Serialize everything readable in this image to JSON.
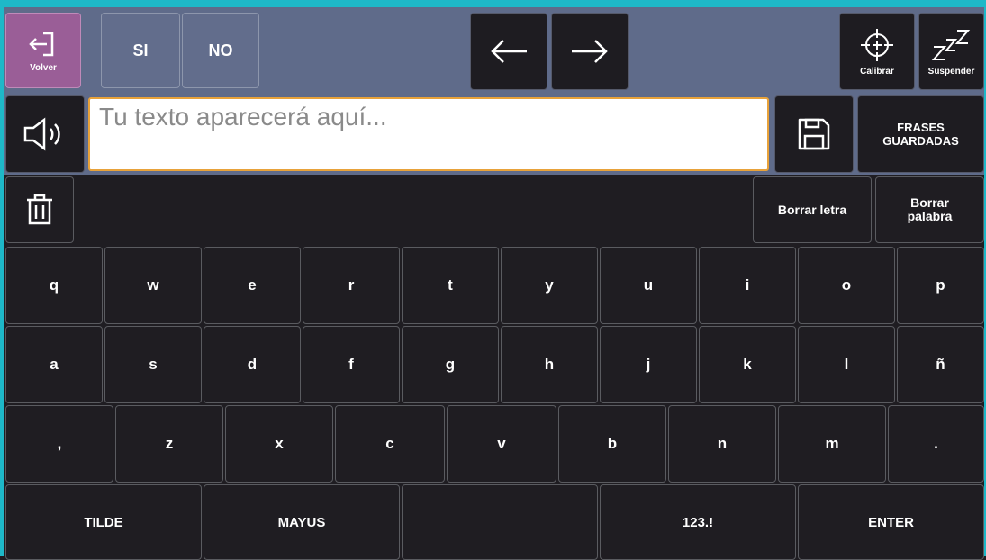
{
  "top": {
    "volver_label": "Volver",
    "si_label": "SI",
    "no_label": "NO",
    "calibrar_label": "Calibrar",
    "suspender_label": "Suspender"
  },
  "text_row": {
    "placeholder": "Tu texto aparecerá aquí...",
    "saved_phrases_label": "FRASES GUARDADAS"
  },
  "edit_row": {
    "delete_letter_label": "Borrar letra",
    "delete_word_label_line1": "Borrar",
    "delete_word_label_line2": "palabra"
  },
  "keyboard": {
    "row1": [
      "q",
      "w",
      "e",
      "r",
      "t",
      "y",
      "u",
      "i",
      "o",
      "p"
    ],
    "row2": [
      "a",
      "s",
      "d",
      "f",
      "g",
      "h",
      "j",
      "k",
      "l",
      "ñ"
    ],
    "row3": [
      ",",
      "z",
      "x",
      "c",
      "v",
      "b",
      "n",
      "m",
      "."
    ],
    "row4": [
      "TILDE",
      "MAYUS",
      "__",
      "123.!",
      "ENTER"
    ]
  },
  "colors": {
    "accent_border": "#1eb8c8",
    "volver_bg": "#9a5e97",
    "toolbar_bg": "#5f6b8a",
    "key_bg": "#1f1d22",
    "text_field_border": "#e8a23a"
  }
}
